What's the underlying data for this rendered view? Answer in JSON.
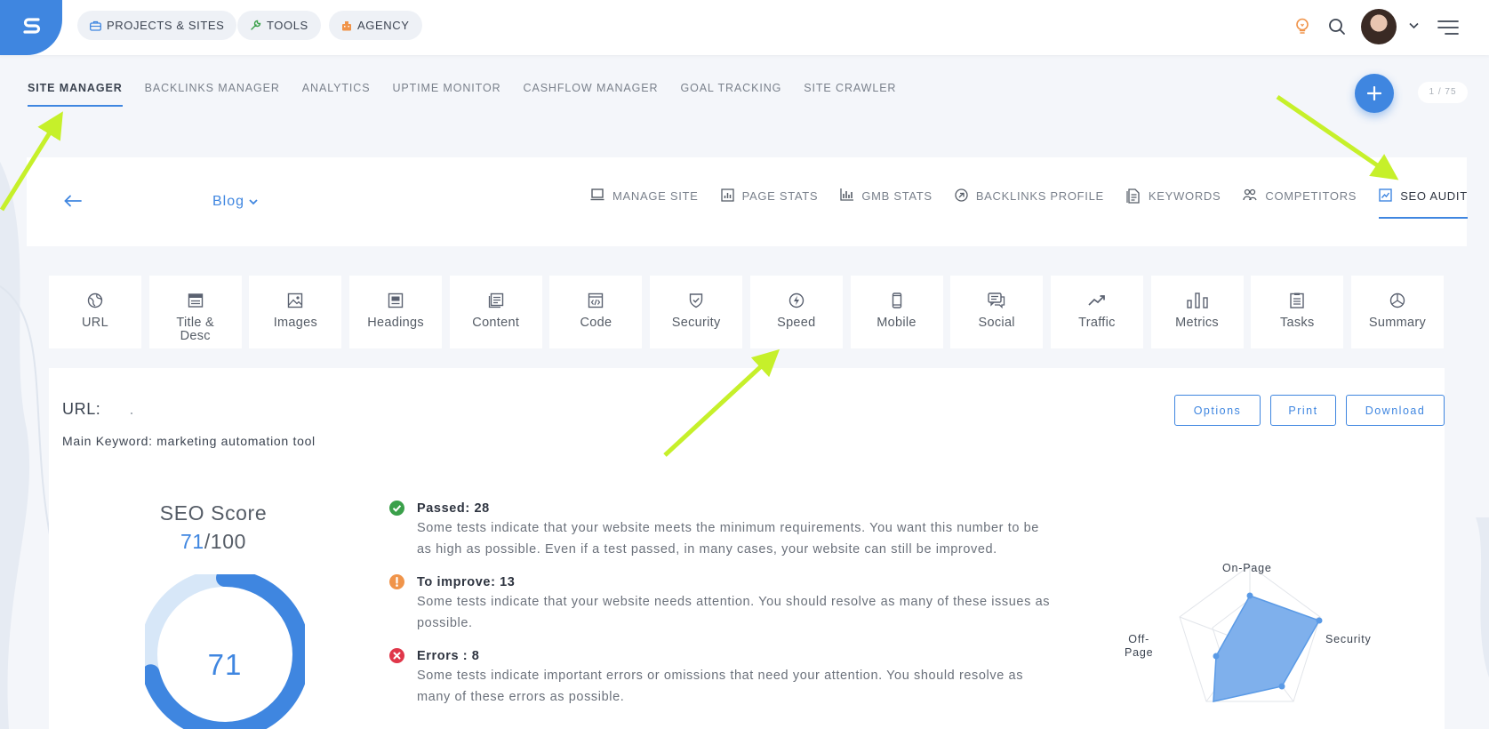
{
  "colors": {
    "accent": "#3f86e0",
    "passed": "#3aa04a",
    "improve": "#f0944a",
    "error": "#e0374a",
    "annotation_arrow": "#c6f02a"
  },
  "topbar": {
    "logo_icon": "brand-logo",
    "pills": [
      {
        "label": "PROJECTS & SITES",
        "icon": "briefcase-icon"
      },
      {
        "label": "TOOLS",
        "icon": "wrench-icon"
      },
      {
        "label": "AGENCY",
        "icon": "building-icon"
      }
    ],
    "icons": [
      "lightbulb-icon",
      "search-icon",
      "chevron-down-icon",
      "menu-icon"
    ]
  },
  "main_nav": {
    "items": [
      {
        "label": "SITE MANAGER",
        "active": true
      },
      {
        "label": "BACKLINKS MANAGER"
      },
      {
        "label": "ANALYTICS"
      },
      {
        "label": "UPTIME MONITOR"
      },
      {
        "label": "CASHFLOW MANAGER"
      },
      {
        "label": "GOAL TRACKING"
      },
      {
        "label": "SITE CRAWLER"
      }
    ]
  },
  "counter": "1 / 75",
  "site": {
    "select_label": "Blog",
    "subnav": [
      {
        "label": "MANAGE SITE",
        "icon": "laptop-icon"
      },
      {
        "label": "PAGE STATS",
        "icon": "bar-chart-icon"
      },
      {
        "label": "GMB STATS",
        "icon": "column-chart-icon"
      },
      {
        "label": "BACKLINKS PROFILE",
        "icon": "link-badge-icon"
      },
      {
        "label": "KEYWORDS",
        "icon": "document-icon"
      },
      {
        "label": "COMPETITORS",
        "icon": "users-icon"
      },
      {
        "label": "SEO AUDIT",
        "icon": "trend-chart-icon",
        "active": true
      }
    ]
  },
  "tiles": [
    {
      "label": "URL",
      "icon": "globe-icon"
    },
    {
      "label": "Title & Desc",
      "icon": "title-card-icon"
    },
    {
      "label": "Images",
      "icon": "image-icon"
    },
    {
      "label": "Headings",
      "icon": "heading-icon"
    },
    {
      "label": "Content",
      "icon": "content-icon"
    },
    {
      "label": "Code",
      "icon": "code-icon"
    },
    {
      "label": "Security",
      "icon": "shield-icon"
    },
    {
      "label": "Speed",
      "icon": "lightning-icon"
    },
    {
      "label": "Mobile",
      "icon": "mobile-icon"
    },
    {
      "label": "Social",
      "icon": "chat-icon"
    },
    {
      "label": "Traffic",
      "icon": "trend-icon"
    },
    {
      "label": "Metrics",
      "icon": "bars-icon"
    },
    {
      "label": "Tasks",
      "icon": "checklist-icon"
    },
    {
      "label": "Summary",
      "icon": "pie-icon"
    }
  ],
  "report": {
    "url_label": "URL:",
    "keyword_line": "Main Keyword: marketing automation tool",
    "buttons": {
      "options": "Options",
      "print": "Print",
      "download": "Download"
    },
    "score": {
      "title": "SEO Score",
      "value": "71",
      "max": "/100",
      "percent": 71
    },
    "results": [
      {
        "type": "passed",
        "title": "Passed: 28",
        "desc": "Some tests indicate that your website meets the minimum requirements. You want this number to be as high as possible. Even if a test passed, in many cases, your website can still be improved."
      },
      {
        "type": "improve",
        "title": "To improve: 13",
        "desc": "Some tests indicate that your website needs attention. You should resolve as many of these issues as possible."
      },
      {
        "type": "error",
        "title": "Errors :  8",
        "desc": "Some tests indicate important errors or omissions that need your attention. You should resolve as many of these errors as possible."
      }
    ],
    "radar": {
      "labels": [
        "On-Page",
        "Security",
        "Off-Page"
      ],
      "off_page_lines": [
        "Off-",
        "Page"
      ]
    }
  }
}
